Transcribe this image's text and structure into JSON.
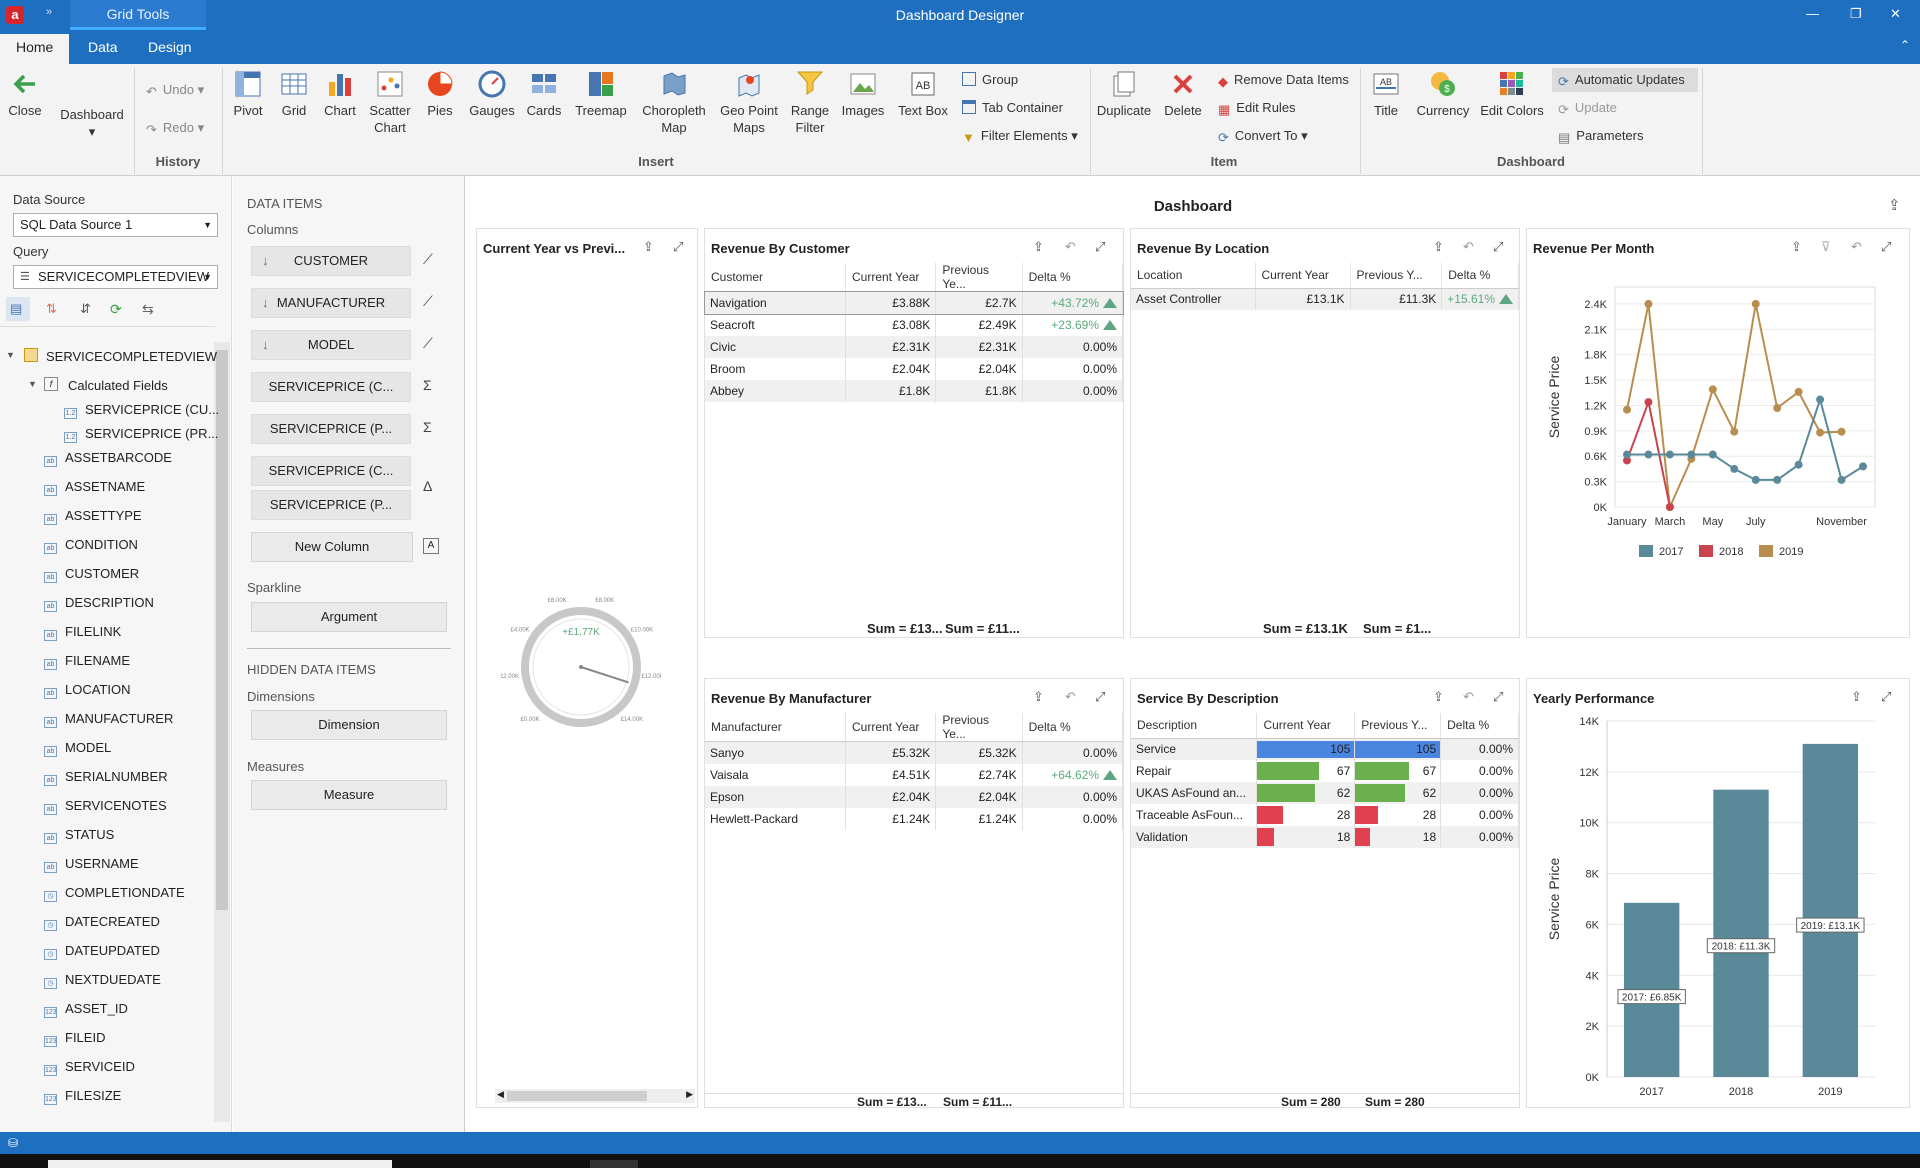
{
  "window": {
    "title": "Dashboard Designer",
    "context_tab": "Grid Tools",
    "app_letter": "a"
  },
  "tabs": [
    "Home",
    "Data",
    "Design"
  ],
  "ribbon": {
    "close": "Close",
    "dashboard": "Dashboard",
    "undo": "Undo",
    "redo": "Redo",
    "history": "History",
    "insert": [
      "Pivot",
      "Grid",
      "Chart",
      "Scatter Chart",
      "Pies",
      "Gauges",
      "Cards",
      "Treemap",
      "Choropleth Map",
      "Geo Point Maps",
      "Range Filter",
      "Images",
      "Text Box"
    ],
    "group": "Group",
    "tab_container": "Tab Container",
    "filter_elements": "Filter Elements",
    "insert_label": "Insert",
    "duplicate": "Duplicate",
    "delete": "Delete",
    "remove_data_items": "Remove Data Items",
    "edit_rules": "Edit Rules",
    "convert_to": "Convert To",
    "item_label": "Item",
    "title": "Title",
    "currency": "Currency",
    "edit_colors": "Edit Colors",
    "automatic_updates": "Automatic Updates",
    "update": "Update",
    "parameters": "Parameters",
    "dashboard_label": "Dashboard"
  },
  "left": {
    "data_source_label": "Data Source",
    "data_source": "SQL Data Source 1",
    "query_label": "Query",
    "query": "SERVICECOMPLETEDVIEW",
    "root": "SERVICECOMPLETEDVIEW",
    "calc": "Calculated Fields",
    "calc_items": [
      "SERVICEPRICE (CU...",
      "SERVICEPRICE (PR..."
    ],
    "fields": [
      "ASSETBARCODE",
      "ASSETNAME",
      "ASSETTYPE",
      "CONDITION",
      "CUSTOMER",
      "DESCRIPTION",
      "FILELINK",
      "FILENAME",
      "LOCATION",
      "MANUFACTURER",
      "MODEL",
      "SERIALNUMBER",
      "SERVICENOTES",
      "STATUS",
      "USERNAME",
      "COMPLETIONDATE",
      "DATECREATED",
      "DATEUPDATED",
      "NEXTDUEDATE",
      "ASSET_ID",
      "FILEID",
      "SERVICEID",
      "FILESIZE"
    ]
  },
  "mid": {
    "data_items": "DATA ITEMS",
    "columns": "Columns",
    "column_items": [
      "CUSTOMER",
      "MANUFACTURER",
      "MODEL",
      "SERVICEPRICE (C...",
      "SERVICEPRICE (P...",
      "SERVICEPRICE (C...",
      "SERVICEPRICE (P..."
    ],
    "new_column": "New Column",
    "sparkline": "Sparkline",
    "argument": "Argument",
    "hidden": "HIDDEN DATA ITEMS",
    "dimensions": "Dimensions",
    "dimension": "Dimension",
    "measures": "Measures",
    "measure": "Measure"
  },
  "dashboard": {
    "title": "Dashboard",
    "gauge": {
      "title": "Current Year vs Previ...",
      "value": "+£1.77K",
      "ticks": [
        "£0.00K",
        "£2.00K",
        "£4.00K",
        "£6.00K",
        "£8.00K",
        "£10.00K",
        "£12.00K",
        "£14.00K"
      ],
      "fraction": 0.9
    },
    "rev_customer": {
      "title": "Revenue By Customer",
      "headers": [
        "Customer",
        "Current Year",
        "Previous Ye...",
        "Delta %"
      ],
      "rows": [
        [
          "Navigation",
          "£3.88K",
          "£2.7K",
          "+43.72%"
        ],
        [
          "Seacroft",
          "£3.08K",
          "£2.49K",
          "+23.69%"
        ],
        [
          "Civic",
          "£2.31K",
          "£2.31K",
          "0.00%"
        ],
        [
          "Broom",
          "£2.04K",
          "£2.04K",
          "0.00%"
        ],
        [
          "Abbey",
          "£1.8K",
          "£1.8K",
          "0.00%"
        ]
      ],
      "sum1": "Sum = £13...",
      "sum2": "Sum = £11..."
    },
    "rev_location": {
      "title": "Revenue By Location",
      "headers": [
        "Location",
        "Current Year",
        "Previous Y...",
        "Delta %"
      ],
      "rows": [
        [
          "Asset Controller",
          "£13.1K",
          "£11.3K",
          "+15.61%"
        ]
      ],
      "sum1": "Sum = £13.1K",
      "sum2": "Sum = £1..."
    },
    "rev_manufacturer": {
      "title": "Revenue By Manufacturer",
      "headers": [
        "Manufacturer",
        "Current Year",
        "Previous Ye...",
        "Delta %"
      ],
      "rows": [
        [
          "Sanyo",
          "£5.32K",
          "£5.32K",
          "0.00%"
        ],
        [
          "Vaisala",
          "£4.51K",
          "£2.74K",
          "+64.62%"
        ],
        [
          "Epson",
          "£2.04K",
          "£2.04K",
          "0.00%"
        ],
        [
          "Hewlett-Packard",
          "£1.24K",
          "£1.24K",
          "0.00%"
        ]
      ],
      "sum1": "Sum = £13...",
      "sum2": "Sum = £11..."
    },
    "service_desc": {
      "title": "Service By Description",
      "headers": [
        "Description",
        "Current Year",
        "Previous Y...",
        "Delta %"
      ],
      "rows": [
        [
          "Service",
          "105",
          "105",
          "0.00%"
        ],
        [
          "Repair",
          "67",
          "67",
          "0.00%"
        ],
        [
          "UKAS AsFound an...",
          "62",
          "62",
          "0.00%"
        ],
        [
          "Traceable AsFoun...",
          "28",
          "28",
          "0.00%"
        ],
        [
          "Validation",
          "18",
          "18",
          "0.00%"
        ]
      ],
      "bar_max": 105,
      "sum1": "Sum = 280",
      "sum2": "Sum = 280"
    },
    "rev_month_title": "Revenue Per Month",
    "yearly_title": "Yearly Performance"
  },
  "colors": {
    "s2017": "#5a8a9a",
    "s2018": "#c9444f",
    "s2019": "#b88e50",
    "blue": "#2f7fd6",
    "bar_blue": "#4a86e0",
    "bar_green": "#6ab04c",
    "bar_red": "#e0404f"
  },
  "chart_data": [
    {
      "type": "line",
      "title": "Revenue Per Month",
      "ylabel": "Service Price",
      "xlabel": "",
      "x": [
        "January",
        "February",
        "March",
        "April",
        "May",
        "June",
        "July",
        "August",
        "September",
        "October",
        "November",
        "December"
      ],
      "x_ticks": [
        "January",
        "March",
        "May",
        "July",
        "November"
      ],
      "y_ticks": [
        "0K",
        "0.3K",
        "0.6K",
        "0.9K",
        "1.2K",
        "1.5K",
        "1.8K",
        "2.1K",
        "2.4K"
      ],
      "ylim": [
        0,
        2600
      ],
      "series": [
        {
          "name": "2017",
          "values": [
            620,
            620,
            620,
            620,
            620,
            450,
            320,
            320,
            500,
            1270,
            320,
            480
          ]
        },
        {
          "name": "2018",
          "values": [
            550,
            1240,
            0,
            null,
            null,
            null,
            null,
            null,
            null,
            null,
            null,
            null
          ]
        },
        {
          "name": "2019",
          "values": [
            1150,
            2400,
            0,
            570,
            1390,
            890,
            2400,
            1170,
            1360,
            880,
            890,
            null
          ]
        }
      ]
    },
    {
      "type": "bar",
      "title": "Yearly Performance",
      "ylabel": "Service Price",
      "xlabel": "",
      "categories": [
        "2017",
        "2018",
        "2019"
      ],
      "values": [
        6850,
        11300,
        13100
      ],
      "data_labels": [
        "2017: £6.85K",
        "2018: £11.3K",
        "2019: £13.1K"
      ],
      "y_ticks": [
        "0K",
        "2K",
        "4K",
        "6K",
        "8K",
        "10K",
        "12K",
        "14K"
      ],
      "ylim": [
        0,
        14000
      ]
    }
  ]
}
